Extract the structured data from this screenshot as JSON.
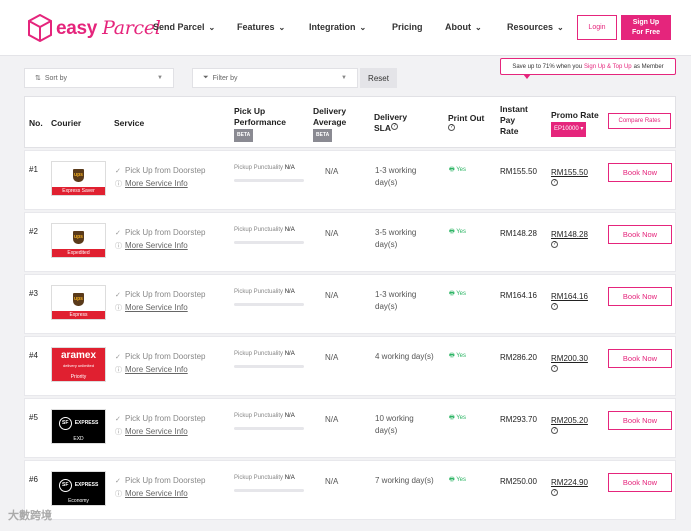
{
  "header": {
    "logo_text": "easy",
    "logo_script": "Parcel",
    "nav": [
      {
        "label": "Send Parcel",
        "dropdown": true
      },
      {
        "label": "Features",
        "dropdown": true
      },
      {
        "label": "Integration",
        "dropdown": true
      },
      {
        "label": "Pricing",
        "dropdown": false
      },
      {
        "label": "About",
        "dropdown": true
      },
      {
        "label": "Resources",
        "dropdown": true
      }
    ],
    "login_label": "Login",
    "signup_label_1": "Sign Up",
    "signup_label_2": "For Free"
  },
  "promo_tip": {
    "prefix": "Save up to 71% when you",
    "link": "Sign Up & Top Up",
    "suffix": "as Member"
  },
  "filters": {
    "sort_label": "Sort by",
    "filter_label": "Filter by",
    "reset_label": "Reset"
  },
  "table": {
    "headers": {
      "no": "No.",
      "courier": "Courier",
      "service": "Service",
      "pickup_1": "Pick Up",
      "pickup_2": "Performance",
      "delivery_1": "Delivery",
      "delivery_2": "Average",
      "beta": "BETA",
      "sla_1": "Delivery",
      "sla_2": "SLA",
      "print": "Print Out",
      "instant_1": "Instant",
      "instant_2": "Pay",
      "instant_3": "Rate",
      "promo": "Promo Rate",
      "promo_code": "EP10000",
      "compare": "Compare Rates"
    },
    "rows": [
      {
        "no": "#1",
        "brand": "ups",
        "service_label": "Express Saver",
        "label_color": "#e02030",
        "pickup": "Pick Up from Doorstep",
        "more": "More Service Info",
        "punct_label": "Pickup Punctuality",
        "punct_value": "N/A",
        "delivery": "N/A",
        "sla": "1-3 working day(s)",
        "print": "Yes",
        "instant": "RM155.50",
        "promo": "RM155.50",
        "book": "Book Now"
      },
      {
        "no": "#2",
        "brand": "ups",
        "service_label": "Expedited",
        "label_color": "#e02030",
        "pickup": "Pick Up from Doorstep",
        "more": "More Service Info",
        "punct_label": "Pickup Punctuality",
        "punct_value": "N/A",
        "delivery": "N/A",
        "sla": "3-5 working day(s)",
        "print": "Yes",
        "instant": "RM148.28",
        "promo": "RM148.28",
        "book": "Book Now"
      },
      {
        "no": "#3",
        "brand": "ups",
        "service_label": "Express",
        "label_color": "#e02030",
        "pickup": "Pick Up from Doorstep",
        "more": "More Service Info",
        "punct_label": "Pickup Punctuality",
        "punct_value": "N/A",
        "delivery": "N/A",
        "sla": "1-3 working day(s)",
        "print": "Yes",
        "instant": "RM164.16",
        "promo": "RM164.16",
        "book": "Book Now"
      },
      {
        "no": "#4",
        "brand": "aramex",
        "service_label": "Priority",
        "label_color": "#e02030",
        "pickup": "Pick Up from Doorstep",
        "more": "More Service Info",
        "punct_label": "Pickup Punctuality",
        "punct_value": "N/A",
        "delivery": "N/A",
        "sla": "4 working day(s)",
        "print": "Yes",
        "instant": "RM286.20",
        "promo": "RM200.30",
        "book": "Book Now"
      },
      {
        "no": "#5",
        "brand": "sf",
        "service_label": "EXD",
        "label_color": "#000000",
        "pickup": "Pick Up from Doorstep",
        "more": "More Service Info",
        "punct_label": "Pickup Punctuality",
        "punct_value": "N/A",
        "delivery": "N/A",
        "sla": "10 working day(s)",
        "print": "Yes",
        "instant": "RM293.70",
        "promo": "RM205.20",
        "book": "Book Now"
      },
      {
        "no": "#6",
        "brand": "sf",
        "service_label": "Economy",
        "label_color": "#000000",
        "pickup": "Pick Up from Doorstep",
        "more": "More Service Info",
        "punct_label": "Pickup Punctuality",
        "punct_value": "N/A",
        "delivery": "N/A",
        "sla": "7 working day(s)",
        "print": "Yes",
        "instant": "RM250.00",
        "promo": "RM224.90",
        "book": "Book Now"
      }
    ]
  },
  "brands": {
    "ups": "ups",
    "aramex": "aramex",
    "aramex_sub": "delivery unlimited",
    "sf": "EXPRESS",
    "sf_mark": "SF"
  },
  "colors": {
    "accent": "#e5257c",
    "ok_green": "#2bb463"
  },
  "watermark": "大數跨境"
}
